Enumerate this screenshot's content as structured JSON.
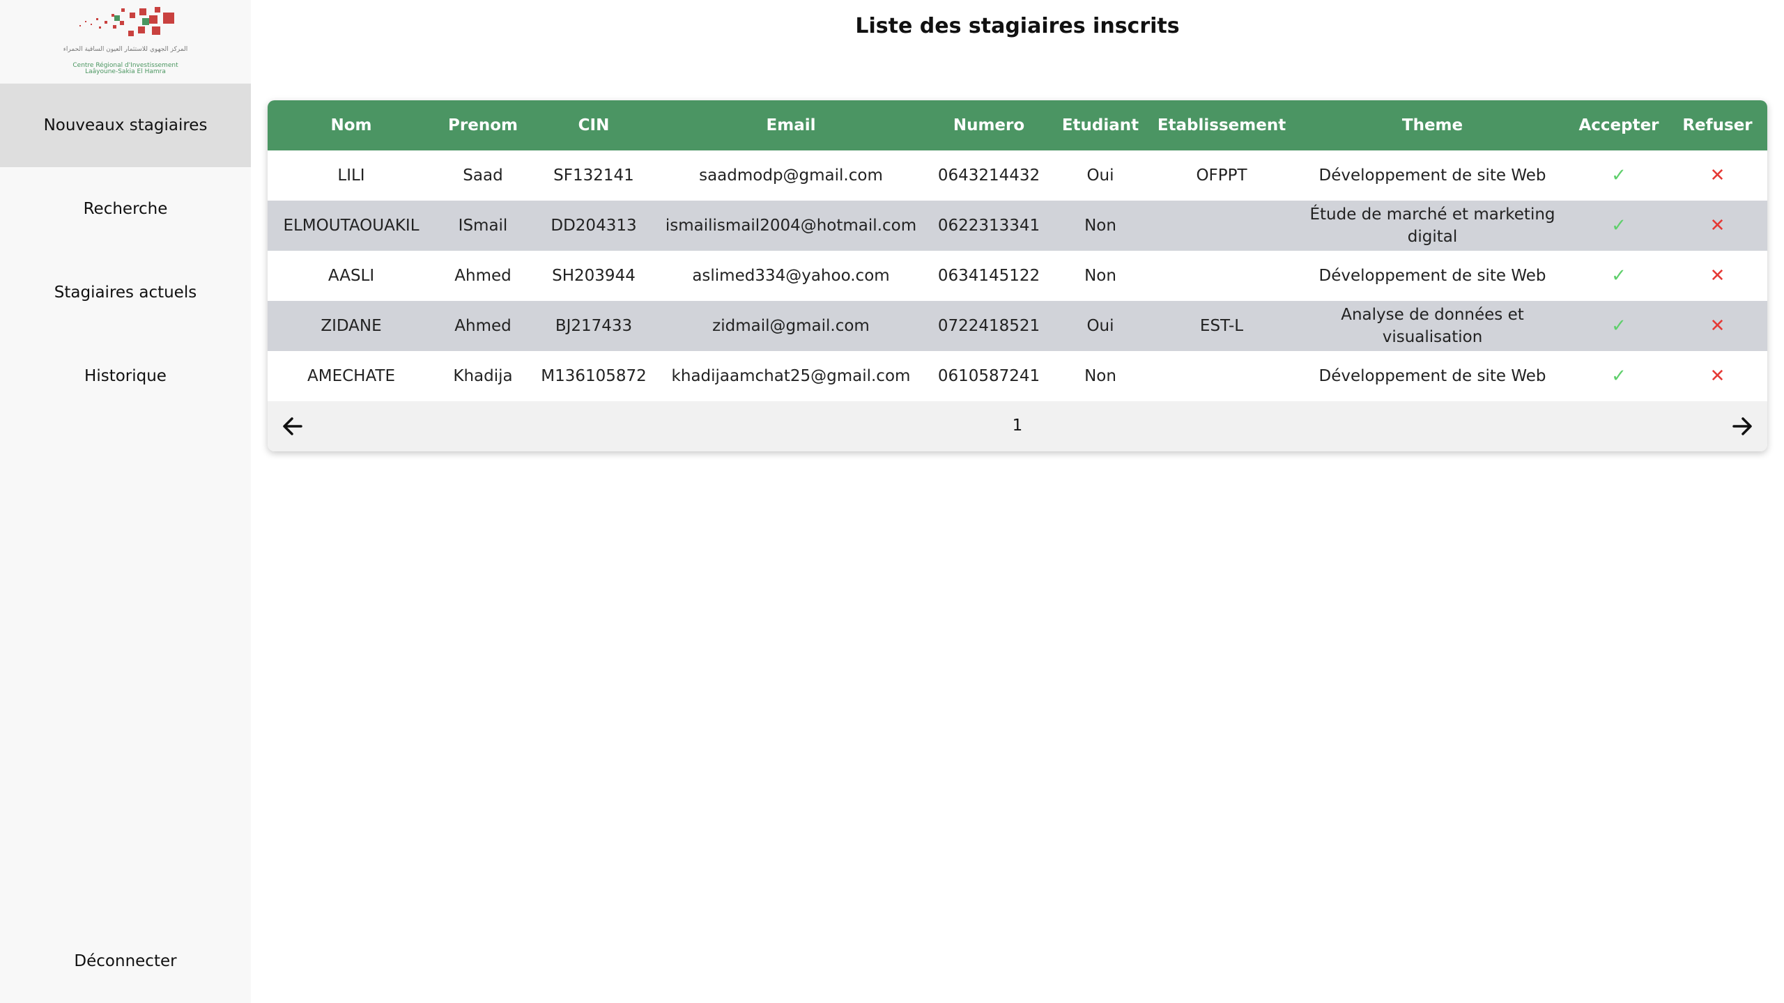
{
  "logo": {
    "arabic_text": "المركز الجهوي للاستثمار العيون الساقية الحمراء",
    "name_line1": "Centre Régional d'Investissement",
    "name_line2": "Laâyoune-Sakia El Hamra"
  },
  "sidebar": {
    "items": [
      {
        "label": "Nouveaux stagiaires",
        "active": true
      },
      {
        "label": "Recherche",
        "active": false
      },
      {
        "label": "Stagiaires actuels",
        "active": false
      },
      {
        "label": "Historique",
        "active": false
      }
    ],
    "logout_label": "Déconnecter"
  },
  "page": {
    "title": "Liste des stagiaires inscrits"
  },
  "table": {
    "headers": [
      "Nom",
      "Prenom",
      "CIN",
      "Email",
      "Numero",
      "Etudiant",
      "Etablissement",
      "Theme",
      "Accepter",
      "Refuser"
    ],
    "rows": [
      [
        "LILI",
        "Saad",
        "SF132141",
        "saadmodp@gmail.com",
        "0643214432",
        "Oui",
        "OFPPT",
        "Développement de site Web"
      ],
      [
        "ELMOUTAOUAKIL",
        "ISmail",
        "DD204313",
        "ismailismail2004@hotmail.com",
        "0622313341",
        "Non",
        "",
        "Étude de marché et marketing digital"
      ],
      [
        "AASLI",
        "Ahmed",
        "SH203944",
        "aslimed334@yahoo.com",
        "0634145122",
        "Non",
        "",
        "Développement de site Web"
      ],
      [
        "ZIDANE",
        "Ahmed",
        "BJ217433",
        "zidmail@gmail.com",
        "0722418521",
        "Oui",
        "EST-L",
        "Analyse de données et visualisation"
      ],
      [
        "AMECHATE",
        "Khadija",
        "M136105872",
        "khadijaamchat25@gmail.com",
        "0610587241",
        "Non",
        "",
        "Développement de site Web"
      ]
    ],
    "accept_icon": "check-icon",
    "refuse_icon": "x-icon"
  },
  "pagination": {
    "current_page": "1",
    "prev_icon": "arrow-left-icon",
    "next_icon": "arrow-right-icon"
  },
  "colors": {
    "header_green": "#4b9563",
    "row_gray": "#d1d3d9",
    "check_green": "#5fcf6c",
    "refuse_red": "#e53935"
  }
}
